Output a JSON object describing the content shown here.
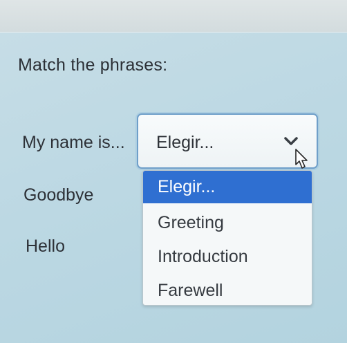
{
  "instruction": "Match the phrases:",
  "rows": [
    {
      "label": "My name is..."
    },
    {
      "label": "Goodbye"
    },
    {
      "label": "Hello"
    }
  ],
  "select": {
    "value": "Elegir...",
    "icon": "chevron-down-icon"
  },
  "dropdown": {
    "options": [
      {
        "label": "Elegir...",
        "selected": true
      },
      {
        "label": "Greeting",
        "selected": false
      },
      {
        "label": "Introduction",
        "selected": false
      },
      {
        "label": "Farewell",
        "selected": false
      }
    ]
  },
  "colors": {
    "highlight": "#2f6fd1",
    "select_border": "#6f9fc9",
    "panel": "#bcd8e3"
  }
}
